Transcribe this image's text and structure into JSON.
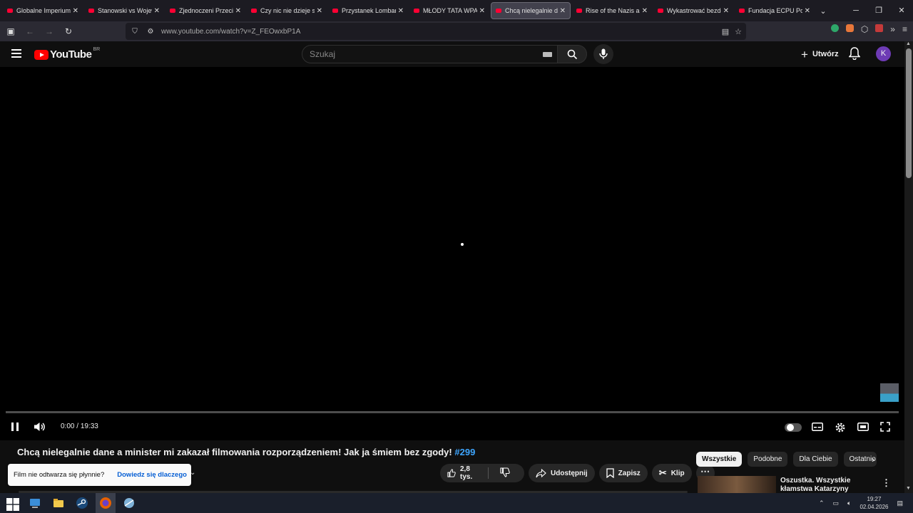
{
  "browser": {
    "tabs": [
      {
        "label": "Globalne Imperium B",
        "active": false
      },
      {
        "label": "Stanowski vs Wojewó",
        "active": false
      },
      {
        "label": "Zjednoczeni Przeciw",
        "active": false
      },
      {
        "label": "Czy nic nie dzieje się",
        "active": false
      },
      {
        "label": "Przystanek Lombard",
        "active": false
      },
      {
        "label": "MŁODY TATA WPADA",
        "active": false
      },
      {
        "label": "Chcą nielegalnie dane",
        "active": true
      },
      {
        "label": "Rise of the Nazis and",
        "active": false
      },
      {
        "label": "Wykastrować bezdom",
        "active": false
      },
      {
        "label": "Fundacja ECPU Polsk",
        "active": false
      }
    ],
    "close_glyph": "✕",
    "url": "www.youtube.com/watch?v=Z_FEOwxbP1A",
    "extension_badge": "10"
  },
  "youtube": {
    "logo_text": "YouTube",
    "country_code": "BR",
    "search_placeholder": "Szukaj",
    "create_label": "Utwórz",
    "avatar_letter": "K"
  },
  "player": {
    "time_current": "0:00",
    "time_separator": "/",
    "time_total": "19:33",
    "progress_fraction": 0.0
  },
  "video": {
    "title": "Chcą nielegalnie dane a minister mi zakazał filmowania rozporządzeniem! Jak ja śmiem bez zgody!",
    "hashtag": "#299",
    "likes": "2,8 tys.",
    "share_label": "Udostępnij",
    "save_label": "Zapisz",
    "clip_label": "Klip"
  },
  "toast": {
    "message": "Film nie odtwarza się płynnie?",
    "link": "Dowiedz się dlaczego"
  },
  "sidebar": {
    "chips": [
      {
        "label": "Wszystkie",
        "active": true
      },
      {
        "label": "Podobne",
        "active": false
      },
      {
        "label": "Dla Ciebie",
        "active": false
      },
      {
        "label": "Ostatnio",
        "active": false
      }
    ],
    "recommendation": {
      "title": "Oszustka. Wszystkie kłamstwa Katarzyny Mecinski - PERSEU..."
    }
  },
  "taskbar": {
    "time": "19:27",
    "date": "02.04.2026"
  },
  "colors": {
    "accent": "#ff0000",
    "link": "#3ea6ff",
    "avatar": "#6e3bb5"
  }
}
